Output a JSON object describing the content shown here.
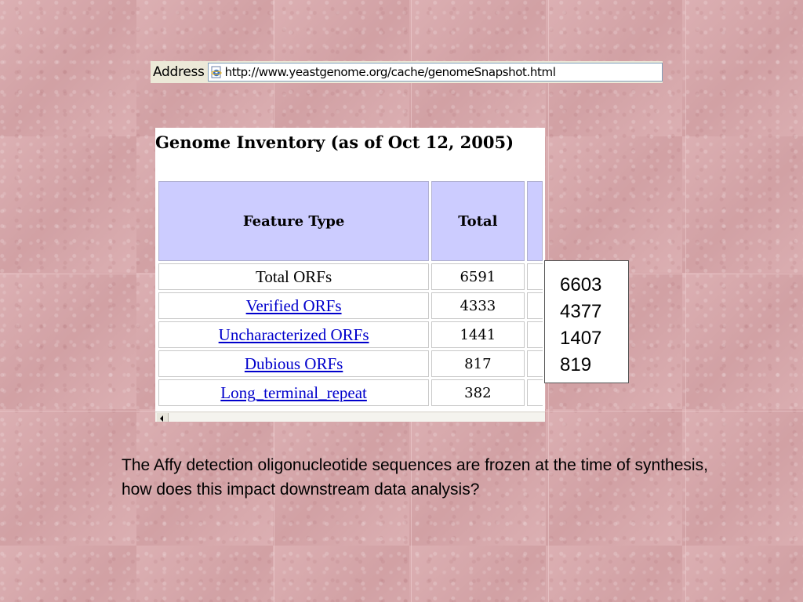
{
  "address_bar": {
    "label": "Address",
    "url": "http://www.yeastgenome.org/cache/genomeSnapshot.html",
    "icon": "ie-page-icon"
  },
  "inventory": {
    "heading": "Genome Inventory (as of Oct 12, 2005)",
    "headers": {
      "feature_type": "Feature Type",
      "total": "Total"
    },
    "rows": [
      {
        "feature": "Total ORFs",
        "total": "6591",
        "is_link": false
      },
      {
        "feature": "Verified ORFs",
        "total": "4333",
        "is_link": true
      },
      {
        "feature": "Uncharacterized ORFs",
        "total": "1441",
        "is_link": true
      },
      {
        "feature": "Dubious ORFs",
        "total": "817",
        "is_link": true
      },
      {
        "feature": "Long_terminal_repeat",
        "total": "382",
        "is_link": true
      }
    ]
  },
  "updated_counts": [
    "6603",
    "4377",
    "1407",
    "819"
  ],
  "caption": "The Affy detection oligonucleotide sequences are frozen at the time of synthesis, how does this impact downstream data analysis?",
  "colors": {
    "background": "#d9a9ac",
    "header_fill": "#ccccff",
    "link": "#0000cc"
  }
}
